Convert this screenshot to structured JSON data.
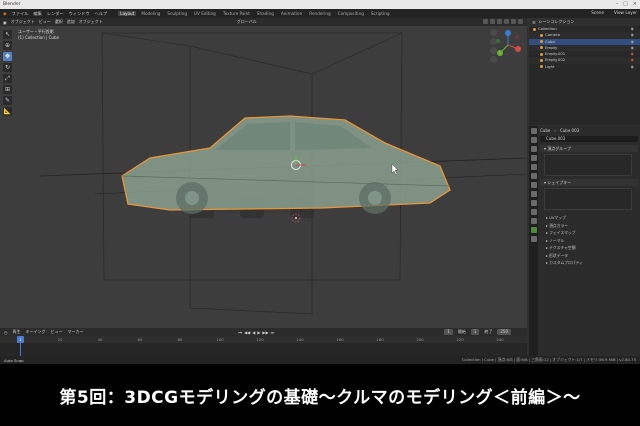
{
  "window": {
    "title": "Blender"
  },
  "menu": {
    "items": [
      "ファイル",
      "編集",
      "レンダー",
      "ウィンドウ",
      "ヘルプ"
    ],
    "workspaces": [
      "Layout",
      "Modeling",
      "Sculpting",
      "UV Editing",
      "Texture Paint",
      "Shading",
      "Animation",
      "Rendering",
      "Compositing",
      "Scripting"
    ],
    "active_workspace": "Layout",
    "scene": "Scene",
    "view_layer": "View Layer"
  },
  "viewport": {
    "header": [
      "オブジェクト",
      "ビュー",
      "選択",
      "追加",
      "オブジェクト"
    ],
    "transform": "グローバル",
    "view_name": "ユーザー・平行投影",
    "collection_info": "(1) Collection | Cube"
  },
  "outliner": {
    "title": "シーンコレクション",
    "rows": [
      {
        "name": "Collection",
        "selected": false,
        "red": false
      },
      {
        "name": "Camera",
        "selected": false,
        "red": false
      },
      {
        "name": "Cube",
        "selected": true,
        "red": false
      },
      {
        "name": "Empty",
        "selected": false,
        "red": false
      },
      {
        "name": "Empty.001",
        "selected": false,
        "red": true
      },
      {
        "name": "Empty.002",
        "selected": false,
        "red": true
      },
      {
        "name": "Light",
        "selected": false,
        "red": false
      }
    ]
  },
  "properties": {
    "object": "Cube",
    "mesh": "Cube.003",
    "mesh_field": "Cube.003",
    "vertex_groups": "頂点グループ",
    "shape_keys": "シェイプキー",
    "sections": [
      "UVマップ",
      "頂点カラー",
      "フェイスマップ",
      "ノーマル",
      "テクスチャ空間",
      "形状データ",
      "カスタムプロパティ"
    ]
  },
  "timeline": {
    "menu": [
      "再生",
      "キーイング",
      "ビュー",
      "マーカー"
    ],
    "current_frame": "1",
    "start_label": "開始",
    "start": "1",
    "end_label": "終了",
    "end": "250",
    "ticks": [
      "0",
      "20",
      "40",
      "60",
      "80",
      "100",
      "120",
      "140",
      "160",
      "180",
      "200",
      "220",
      "240"
    ]
  },
  "status": {
    "left": "Auto Snap",
    "right": "Collection | Cube | 頂点:8/8 | 面:6/6 | 三角面:12 | オブジェクト:1/7 | メモリ:56.9 MiB | v2.80.75"
  },
  "banner": {
    "title": "第5回：3DCGモデリングの基礎〜クルマのモデリング＜前編＞〜"
  },
  "colors": {
    "selection_outline": "#e8953a",
    "car_body": "#8aa08f",
    "active_tool": "#5680c2"
  }
}
